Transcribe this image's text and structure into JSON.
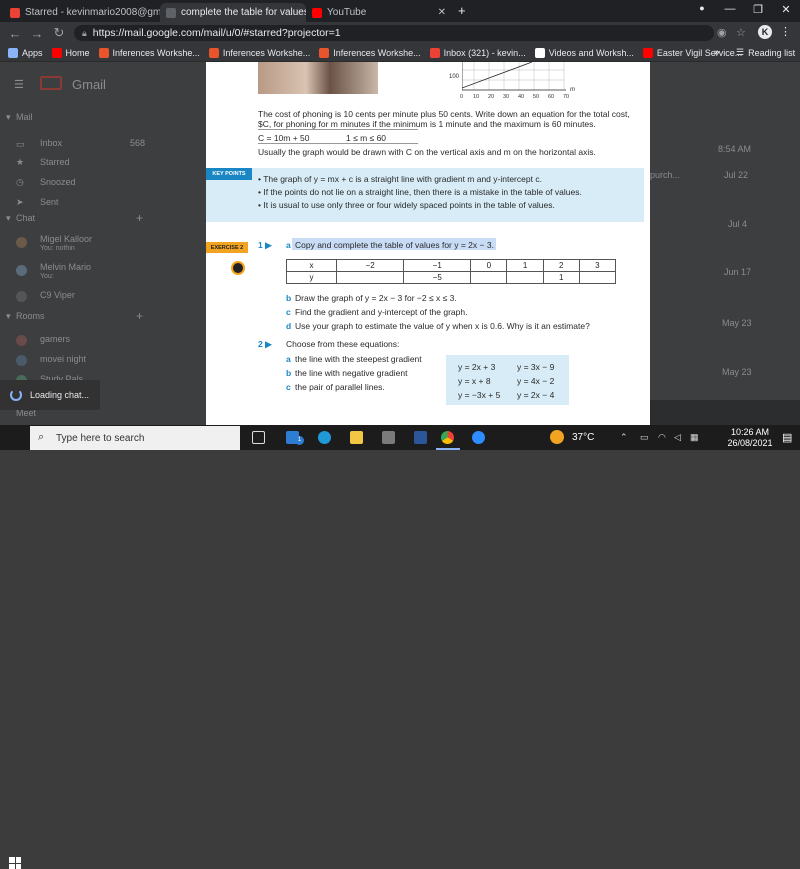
{
  "browser": {
    "tabs": [
      {
        "title": "Starred - kevinmario2008@gmail",
        "color": "#ea4335",
        "active": false
      },
      {
        "title": "complete the table for values y=",
        "color": "#202124",
        "active": true
      },
      {
        "title": "YouTube",
        "color": "#ff0000",
        "active": false
      }
    ],
    "new_tab": "+",
    "url": "https://mail.google.com/mail/u/0/#starred?projector=1",
    "profile_initial": "K",
    "bookmarks": [
      {
        "label": "Apps",
        "color": "#8ab4f8"
      },
      {
        "label": "Home",
        "color": "#ff0000"
      },
      {
        "label": "Inferences Workshe...",
        "color": "#e8542b"
      },
      {
        "label": "Inferences Workshe...",
        "color": "#e8542b"
      },
      {
        "label": "Inferences Workshe...",
        "color": "#e8542b"
      },
      {
        "label": "Inbox (321) - kevin...",
        "color": "#ea4335"
      },
      {
        "label": "Videos and Worksh...",
        "color": "#ffffff"
      },
      {
        "label": "Easter Vigil Service...",
        "color": "#ff0000"
      }
    ],
    "more_bookmarks": "»",
    "reading_list": "Reading list"
  },
  "gmail": {
    "logo": "Gmail",
    "mail_header": "Mail",
    "nav": [
      "Inbox",
      "Starred",
      "Snoozed",
      "Sent"
    ],
    "inbox_count": "568",
    "chat_header": "Chat",
    "chats": [
      {
        "name": "Migel Kalloor",
        "sub": "You: nothin"
      },
      {
        "name": "Melvin Mario",
        "sub": "You:"
      },
      {
        "name": "C9 Viper",
        "sub": ""
      }
    ],
    "rooms_header": "Rooms",
    "rooms": [
      "gamers",
      "movei night",
      "Study Pals"
    ],
    "meet_header": "Meet",
    "dates": [
      "8:54 AM",
      "Jul 22",
      "Jul 4",
      "Jun 17",
      "May 23",
      "May 23"
    ],
    "snippet": "purch...",
    "loading": "Loading chat..."
  },
  "doc": {
    "graph_ticks_x": [
      "0",
      "10",
      "20",
      "30",
      "40",
      "50",
      "60",
      "70"
    ],
    "graph_tick_y": "100",
    "graph_axis_m": "m",
    "para1": "The cost of phoning is 10 cents per minute plus 50 cents. Write down an equation for the total cost,",
    "para1b": "$C, for phoning for m minutes if the minimum is 1 minute and the maximum is 60 minutes.",
    "eq1": "C = 10m + 50",
    "eq1_range": "1 ≤ m ≤ 60",
    "para2": "Usually the graph would be drawn with C on the vertical axis and m on the horizontal axis.",
    "key_points_label": "KEY POINTS",
    "key_points": [
      "The graph of y = mx + c is a straight line with gradient m and y-intercept c.",
      "If the points do not lie on a straight line, then there is a mistake in the table of values.",
      "It is usual to use only three or four widely spaced points in the table of values."
    ],
    "exercise_label": "EXERCISE 2",
    "q1_num": "1 ▶",
    "q1a_letter": "a",
    "q1a": "Copy and complete the table of values for y = 2x − 3.",
    "table_x": [
      "x",
      "−2",
      "−1",
      "0",
      "1",
      "2",
      "3"
    ],
    "table_y": [
      "y",
      "",
      "−5",
      "",
      "",
      "1",
      ""
    ],
    "q1b_letter": "b",
    "q1b": "Draw the graph of y = 2x − 3 for −2 ≤ x ≤ 3.",
    "q1c_letter": "c",
    "q1c": "Find the gradient and y-intercept of the graph.",
    "q1d_letter": "d",
    "q1d": "Use your graph to estimate the value of y when x is 0.6. Why is it an estimate?",
    "q2_num": "2 ▶",
    "q2": "Choose from these equations:",
    "q2a_letter": "a",
    "q2a": "the line with the steepest gradient",
    "q2b_letter": "b",
    "q2b": "the line with negative gradient",
    "q2c_letter": "c",
    "q2c": "the pair of parallel lines.",
    "equations": [
      "y = 2x + 3",
      "y = 3x − 9",
      "y = x + 8",
      "y = 4x − 2",
      "y = −3x + 5",
      "y = 2x − 4"
    ]
  },
  "taskbar": {
    "search_placeholder": "Type here to search",
    "temperature": "37°C",
    "time": "10:26 AM",
    "date": "26/08/2021",
    "notification_count": "1"
  }
}
